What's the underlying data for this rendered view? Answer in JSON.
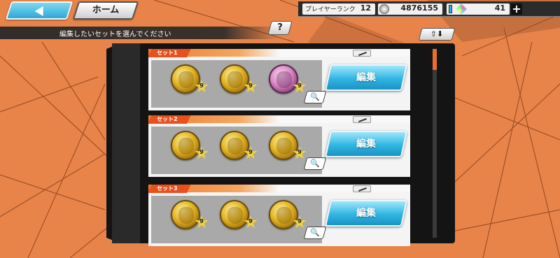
{
  "header": {
    "home_label": "ホーム",
    "player_rank_label": "プレイヤーランク",
    "player_rank_value": "12",
    "coins_value": "4876155",
    "gems_value": "41",
    "plus_label": "+"
  },
  "instruction": {
    "text": "編集したいセットを選んでください",
    "help_label": "?",
    "sort_label": "⇧⬇"
  },
  "sets": [
    {
      "tag": "セット1",
      "edit_label": "編集",
      "medals": [
        "gold",
        "gold",
        "pink"
      ],
      "stars": [
        "9",
        "9",
        "9"
      ]
    },
    {
      "tag": "セット2",
      "edit_label": "編集",
      "medals": [
        "gold",
        "gold",
        "gold"
      ],
      "stars": [
        "9",
        "9",
        "9"
      ]
    },
    {
      "tag": "セット3",
      "edit_label": "編集",
      "medals": [
        "gold",
        "gold",
        "gold"
      ],
      "stars": [
        "9",
        "9",
        "9"
      ]
    }
  ],
  "colors": {
    "background": "#e8844a",
    "accent_orange": "#f07a2c",
    "button_blue": "#30b6e2",
    "panel_dark": "#141414"
  },
  "icons": [
    "back-arrow-icon",
    "coin-icon",
    "gem-icon",
    "help-icon",
    "sort-icon",
    "rename-icon",
    "zoom-icon",
    "star-icon"
  ]
}
